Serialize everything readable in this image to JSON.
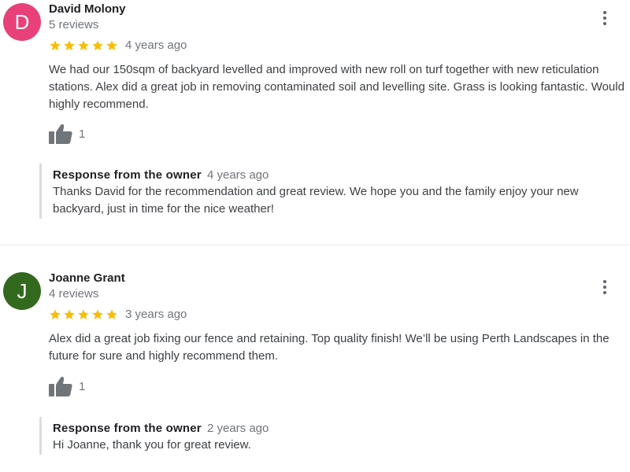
{
  "reviews": [
    {
      "avatar_letter": "D",
      "avatar_color": "#e8417a",
      "name": "David Molony",
      "reviews_count": "5 reviews",
      "rating": 5,
      "time": "4 years ago",
      "text": "We had our 150sqm of backyard levelled and improved with new roll on turf together with new reticulation stations. Alex did a great job in removing contaminated soil and levelling site. Grass is looking fantastic. Would highly recommend.",
      "likes": "1",
      "owner_response": {
        "title": "Response from the owner",
        "time": "4 years ago",
        "text": "Thanks David for the recommendation and great review. We hope you and the family enjoy your new backyard, just in time for the nice weather!"
      }
    },
    {
      "avatar_letter": "J",
      "avatar_color": "#33691e",
      "name": "Joanne Grant",
      "reviews_count": "4 reviews",
      "rating": 5,
      "time": "3 years ago",
      "text": "Alex did a great job fixing our fence and retaining. Top quality finish! We’ll be using Perth Landscapes in the future for sure and highly recommend them.",
      "likes": "1",
      "owner_response": {
        "title": "Response from the owner",
        "time": "2 years ago",
        "text": "Hi Joanne, thank you for great review."
      }
    }
  ],
  "icons": {
    "star": "star-icon",
    "more": "more-vert-icon",
    "like": "thumb-up-icon"
  },
  "colors": {
    "star": "#fbbc04",
    "icon_gray": "#70757a",
    "border": "#dadce0"
  }
}
